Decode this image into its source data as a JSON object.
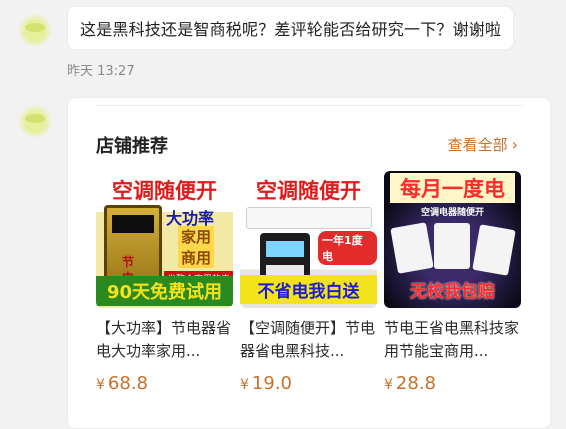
{
  "message": {
    "text": "这是黑科技还是智商税呢？差评轮能否给研究一下？谢谢啦",
    "time": "昨天 13:27"
  },
  "shop_card": {
    "title": "店铺推荐",
    "view_all": "查看全部",
    "products": [
      {
        "image_text": [
          "空调随便开",
          "大功率",
          "家用",
          "商用",
          "省整个家里的电",
          "节",
          "电",
          "器",
          "90天免费试用"
        ],
        "name": "【大功率】节电器省电大功率家用...",
        "price": "68.8"
      },
      {
        "image_text": [
          "空调随便开",
          "一年1度电",
          "不省电我白送"
        ],
        "name": "【空调随便开】节电器省电黑科技...",
        "price": "19.0"
      },
      {
        "image_text": [
          "每月一度电",
          "空调电器随便开",
          "无校我包赔"
        ],
        "name": "节电王省电黑科技家用节能宝商用...",
        "price": "28.8"
      }
    ],
    "currency": "¥"
  },
  "colors": {
    "accent": "#c8702a",
    "background": "#f2f2f3"
  }
}
